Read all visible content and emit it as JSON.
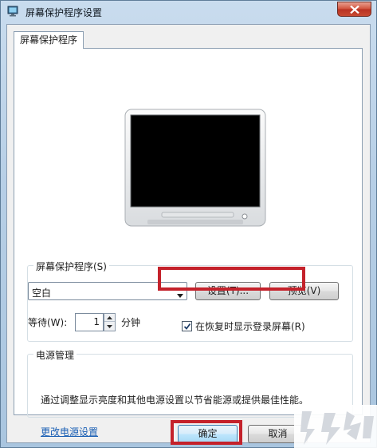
{
  "window": {
    "title": "屏幕保护程序设置",
    "icon": "screensaver-settings-icon",
    "close_icon": "close-icon"
  },
  "tab": {
    "label": "屏幕保护程序"
  },
  "screensaver": {
    "group_label": "屏幕保护程序(S)",
    "selected": "空白",
    "settings_button": "设置(T)...",
    "preview_button": "预览(V)",
    "wait_label": "等待(W):",
    "wait_value": "1",
    "wait_unit": "分钟",
    "resume_checkbox_label": "在恢复时显示登录屏幕(R)",
    "resume_checked": true
  },
  "power": {
    "group_label": "电源管理",
    "description": "通过调整显示亮度和其他电源设置以节省能源或提供最佳性能。",
    "link": "更改电源设置"
  },
  "footer": {
    "ok_button": "确定",
    "cancel_button": "取消"
  },
  "colors": {
    "highlight": "#c4222b",
    "link": "#1a5fb4"
  }
}
